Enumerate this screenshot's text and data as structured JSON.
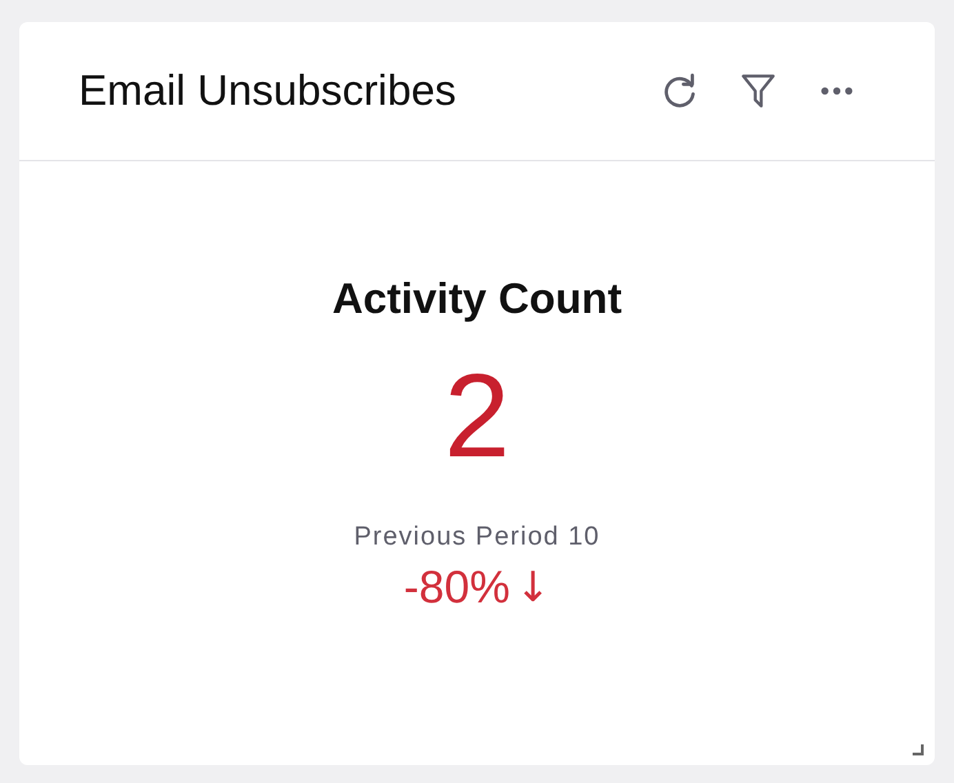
{
  "card": {
    "title": "Email Unsubscribes",
    "actions": [
      {
        "kind": "refresh"
      },
      {
        "kind": "filter"
      },
      {
        "kind": "more"
      }
    ]
  },
  "metric": {
    "title": "Activity Count",
    "value": "2",
    "previous": "Previous Period 10",
    "change": "-80%",
    "arrow": "↓"
  }
}
